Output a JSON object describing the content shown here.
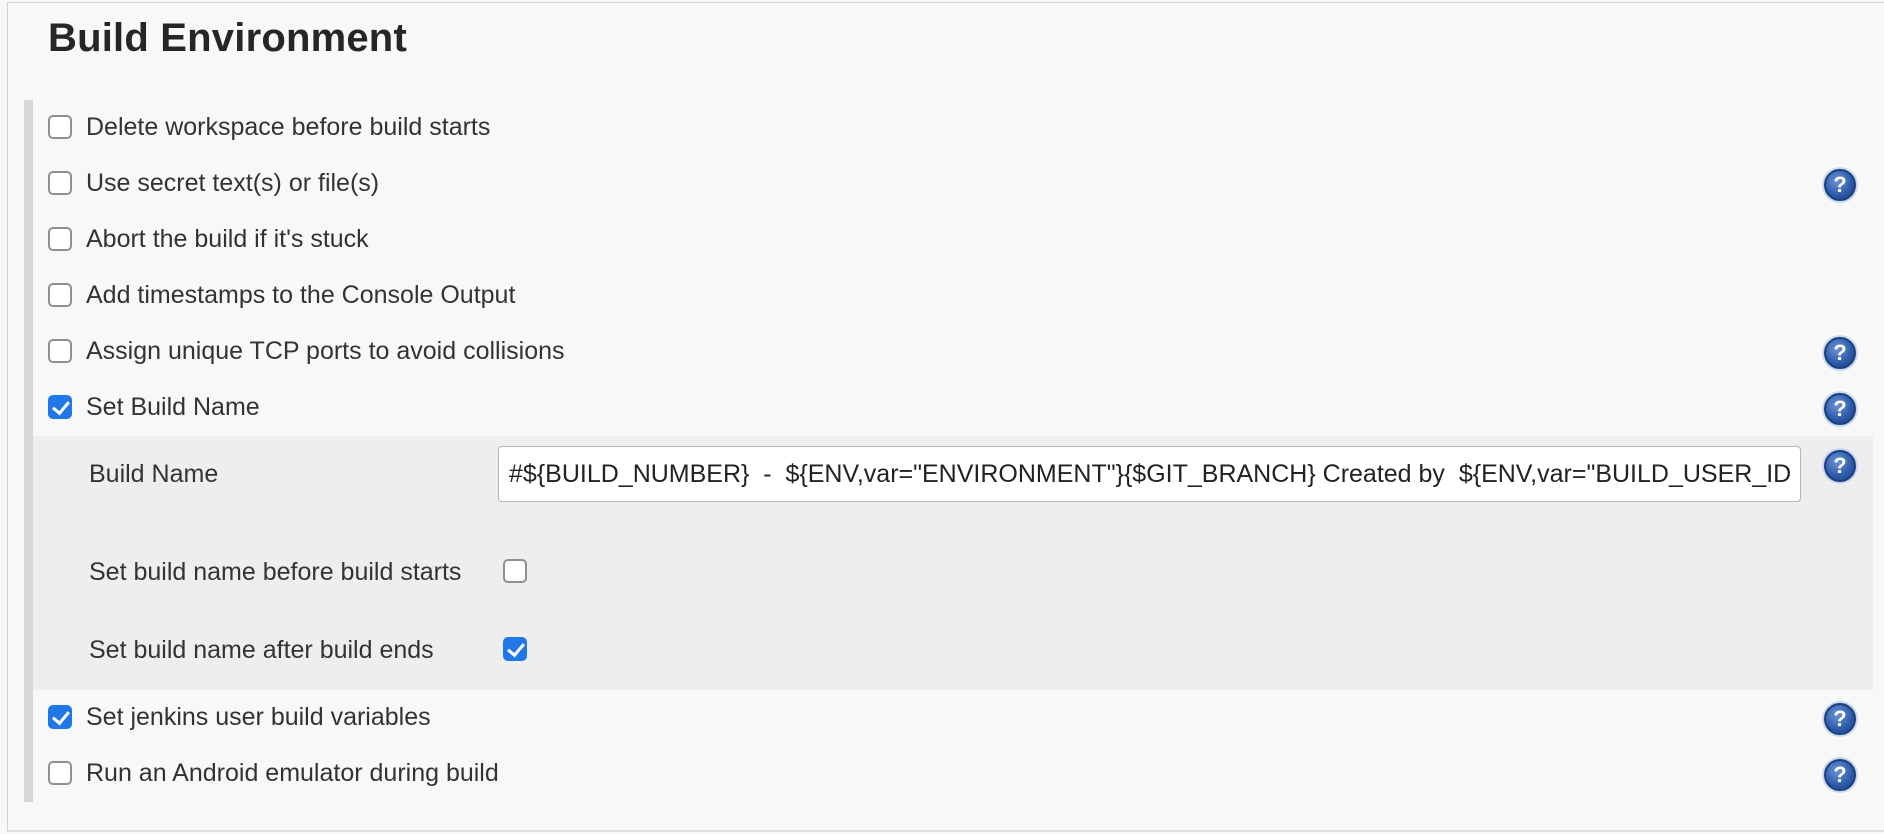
{
  "section": {
    "title": "Build Environment"
  },
  "options": {
    "delete_workspace": {
      "label": "Delete workspace before build starts",
      "checked": false
    },
    "secret_text": {
      "label": "Use secret text(s) or file(s)",
      "checked": false
    },
    "abort_stuck": {
      "label": "Abort the build if it's stuck",
      "checked": false
    },
    "timestamps": {
      "label": "Add timestamps to the Console Output",
      "checked": false
    },
    "tcp_ports": {
      "label": "Assign unique TCP ports to avoid collisions",
      "checked": false
    },
    "set_build_name": {
      "label": "Set Build Name",
      "checked": true
    },
    "jenkins_user_vars": {
      "label": "Set jenkins user build variables",
      "checked": true
    },
    "android_emulator": {
      "label": "Run an Android emulator during build",
      "checked": false
    }
  },
  "build_name_config": {
    "name_label": "Build Name",
    "name_value": "#${BUILD_NUMBER}  -  ${ENV,var=\"ENVIRONMENT\"}{$GIT_BRANCH} Created by  ${ENV,var=\"BUILD_USER_ID\"}",
    "before_label": "Set build name before build starts",
    "before_checked": false,
    "after_label": "Set build name after build ends",
    "after_checked": true
  },
  "help_icon": {
    "glyph": "?",
    "icon": "help-icon",
    "color": "#2c5aa8"
  },
  "colors": {
    "checkbox_checked": "#1f77e8",
    "panel_bg": "#eeeeee"
  }
}
